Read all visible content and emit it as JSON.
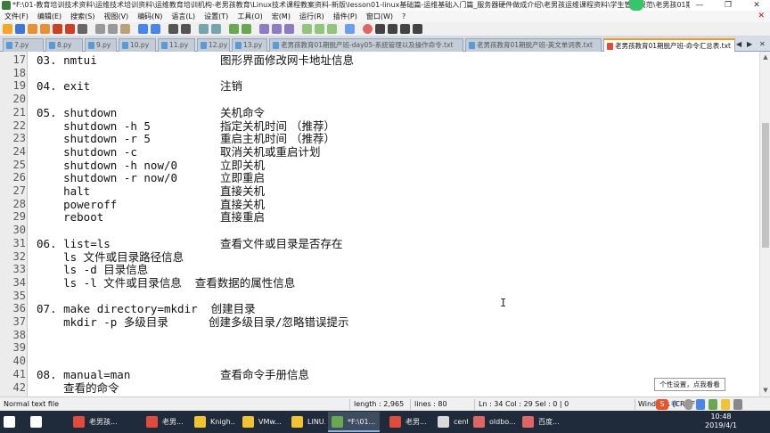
{
  "window": {
    "title": "*F:\\01-教育培训技术资料\\运维技术培训资料\\运维教育培训机构-老男孩教育\\Linux技术课程教案资料-新版\\lesson01-linux基础篇-运维基础入门篇_服务器硬件做成介绍\\老男孩运维课程资料\\学生管理规范\\老男孩01期深...",
    "minimize": "—",
    "maximize": "❐",
    "close": "✕"
  },
  "menu": {
    "items": [
      "文件(F)",
      "编辑(E)",
      "搜索(S)",
      "视图(V)",
      "编码(N)",
      "语言(L)",
      "设置(T)",
      "工具(O)",
      "宏(M)",
      "运行(R)",
      "插件(P)",
      "窗口(W)",
      "?"
    ],
    "close_doc": "✕"
  },
  "tabs": [
    {
      "label": "7.py",
      "active": false
    },
    {
      "label": "8.py",
      "active": false
    },
    {
      "label": "9.py",
      "active": false
    },
    {
      "label": "10.py",
      "active": false
    },
    {
      "label": "11.py",
      "active": false
    },
    {
      "label": "12.py",
      "active": false
    },
    {
      "label": "13.py",
      "active": false
    },
    {
      "label": "老男孩教育01期脱产班-day05-系统管理以及操作命令.txt",
      "active": false
    },
    {
      "label": "老男孩教育01期脱产班-英文单词表.txt",
      "active": false
    },
    {
      "label": "老男孩教育01期脱产班-命令汇总表.txt",
      "active": true
    }
  ],
  "tab_nav": {
    "prev": "◀",
    "next": "▶",
    "close": "✕"
  },
  "editor": {
    "lines": [
      {
        "n": "17",
        "code": "03. nmtui",
        "desc": "图形界面修改网卡地址信息"
      },
      {
        "n": "18",
        "code": "",
        "desc": ""
      },
      {
        "n": "19",
        "code": "04. exit",
        "desc": "注销"
      },
      {
        "n": "20",
        "code": "",
        "desc": ""
      },
      {
        "n": "21",
        "code": "05. shutdown",
        "desc": "关机命令"
      },
      {
        "n": "22",
        "code": "    shutdown -h 5",
        "desc": "指定关机时间 （推荐）"
      },
      {
        "n": "23",
        "code": "    shutdown -r 5",
        "desc": "重启主机时间 （推荐）"
      },
      {
        "n": "24",
        "code": "    shutdown -c",
        "desc": "取消关机或重启计划"
      },
      {
        "n": "25",
        "code": "    shutdown -h now/0",
        "desc": "立即关机"
      },
      {
        "n": "26",
        "code": "    shutdown -r now/0",
        "desc": "立即重启"
      },
      {
        "n": "27",
        "code": "    halt",
        "desc": "直接关机"
      },
      {
        "n": "28",
        "code": "    poweroff",
        "desc": "直接关机"
      },
      {
        "n": "29",
        "code": "    reboot",
        "desc": "直接重启"
      },
      {
        "n": "30",
        "code": "",
        "desc": ""
      },
      {
        "n": "31",
        "code": "06. list=ls",
        "desc": "查看文件或目录是否存在"
      },
      {
        "n": "32",
        "code": "    ls 文件或目录路径信息",
        "desc": ""
      },
      {
        "n": "33",
        "code": "    ls -d 目录信息",
        "desc": ""
      },
      {
        "n": "34",
        "code": "    ls -l 文件或目录信息  查看数据的属性信息",
        "desc": ""
      },
      {
        "n": "35",
        "code": "",
        "desc": ""
      },
      {
        "n": "36",
        "code": "07. make directory=mkdir  创建目录",
        "desc": ""
      },
      {
        "n": "37",
        "code": "    mkdir -p 多级目录      创建多级目录/忽略错误提示",
        "desc": ""
      },
      {
        "n": "38",
        "code": "",
        "desc": ""
      },
      {
        "n": "39",
        "code": "",
        "desc": ""
      },
      {
        "n": "40",
        "code": "",
        "desc": ""
      },
      {
        "n": "41",
        "code": "08. manual=man",
        "desc": "查看命令手册信息"
      },
      {
        "n": "42",
        "code": "    查看的命令",
        "desc": ""
      }
    ]
  },
  "tooltip": "个性设置，点我看看",
  "status": {
    "file_type": "Normal text file",
    "length": "length : 2,965",
    "lines": "lines : 80",
    "position": "Ln : 34   Col : 29   Sel : 0 | 0",
    "eol": "Windows (CR LF)",
    "ime_logo": "S",
    "ime_lang": "中"
  },
  "taskbar": {
    "items": [
      {
        "label": "",
        "color": "#ffffff",
        "active": false
      },
      {
        "label": "",
        "color": "#ffffff",
        "active": false
      },
      {
        "label": "老男孩...",
        "color": "#e14b3b",
        "active": false
      },
      {
        "label": "老男...",
        "color": "#e14b3b",
        "active": false
      },
      {
        "label": "Knigh...",
        "color": "#f1c232",
        "active": false
      },
      {
        "label": "VMw...",
        "color": "#f1c232",
        "active": false
      },
      {
        "label": "LINU...",
        "color": "#f1c232",
        "active": false
      },
      {
        "label": "*F:\\01...",
        "color": "#6aa84f",
        "active": true
      },
      {
        "label": "老男...",
        "color": "#e14b3b",
        "active": false
      },
      {
        "label": "cento...",
        "color": "#d9d9d9",
        "active": false
      },
      {
        "label": "oldbo...",
        "color": "#e06666",
        "active": false
      },
      {
        "label": "百度...",
        "color": "#e06666",
        "active": false
      }
    ],
    "time": "10:48",
    "date": "2019/4/1"
  }
}
